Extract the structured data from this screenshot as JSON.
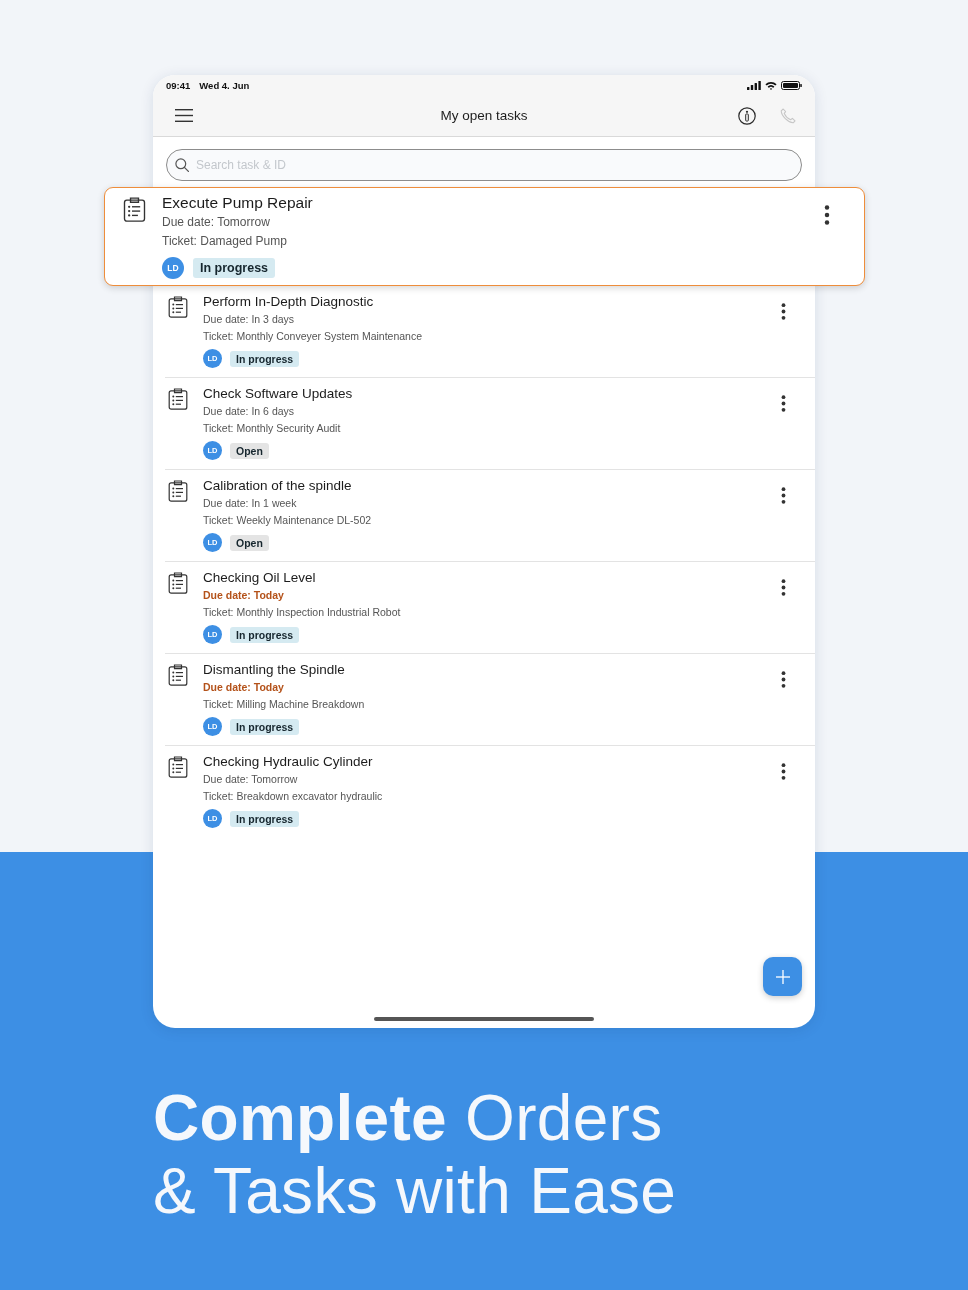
{
  "status_bar": {
    "time": "09:41",
    "date": "Wed 4. Jun"
  },
  "nav_bar": {
    "title": "My open tasks",
    "actions": [
      {
        "kind": "info",
        "disabled": false
      },
      {
        "kind": "call",
        "disabled": true
      }
    ]
  },
  "search": {
    "placeholder": "Search task & ID"
  },
  "tasks": [
    {
      "title": "Execute Pump Repair",
      "due": "Due date: Tomorrow",
      "due_today": false,
      "ticket": "Ticket: Damaged Pump",
      "assignee": "LD",
      "status": {
        "label": "In progress",
        "kind": "in_progress"
      },
      "selected": true
    },
    {
      "title": "Perform In-Depth Diagnostic",
      "due": "Due date: In 3 days",
      "due_today": false,
      "ticket": "Ticket: Monthly Conveyer System Maintenance",
      "assignee": "LD",
      "status": {
        "label": "In progress",
        "kind": "in_progress"
      },
      "selected": false
    },
    {
      "title": "Check Software Updates",
      "due": "Due date: In 6 days",
      "due_today": false,
      "ticket": "Ticket: Monthly Security Audit",
      "assignee": "LD",
      "status": {
        "label": "Open",
        "kind": "open"
      },
      "selected": false
    },
    {
      "title": "Calibration of the spindle",
      "due": "Due date: In 1 week",
      "due_today": false,
      "ticket": "Ticket: Weekly Maintenance DL-502",
      "assignee": "LD",
      "status": {
        "label": "Open",
        "kind": "open"
      },
      "selected": false
    },
    {
      "title": "Checking Oil Level",
      "due": "Due date: Today",
      "due_today": true,
      "ticket": "Ticket: Monthly Inspection Industrial Robot",
      "assignee": "LD",
      "status": {
        "label": "In progress",
        "kind": "in_progress"
      },
      "selected": false
    },
    {
      "title": "Dismantling the Spindle",
      "due": "Due date: Today",
      "due_today": true,
      "ticket": "Ticket: Milling Machine Breakdown",
      "assignee": "LD",
      "status": {
        "label": "In progress",
        "kind": "in_progress"
      },
      "selected": false
    },
    {
      "title": "Checking Hydraulic Cylinder",
      "due": "Due date: Tomorrow",
      "due_today": false,
      "ticket": "Ticket: Breakdown excavator hydraulic",
      "assignee": "LD",
      "status": {
        "label": "In progress",
        "kind": "in_progress"
      },
      "selected": false
    }
  ],
  "headline": "**Complete** Orders\n& Tasks with Ease"
}
